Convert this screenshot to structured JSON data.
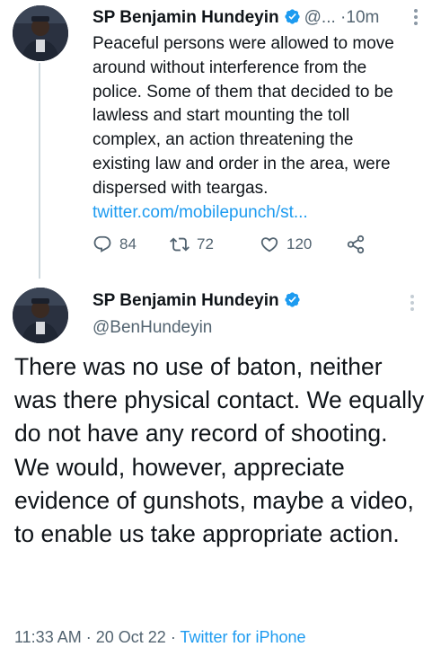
{
  "tweet1": {
    "author_name": "SP Benjamin Hundeyin",
    "handle_truncated": "@...",
    "separator": "·",
    "time": "10m",
    "text": "Peaceful persons were allowed to move around without interference from the police. Some of them that decided to be lawless and start mounting the toll complex, an action threatening the existing law and order in the area, were dispersed with teargas.",
    "link": "twitter.com/mobilepunch/st...",
    "replies": "84",
    "retweets": "72",
    "likes": "120"
  },
  "tweet2": {
    "author_name": "SP Benjamin Hundeyin",
    "handle": "@BenHundeyin",
    "text": "There was no use of baton, neither was there physical contact. We equally do not have any record of shooting. We would, however, appreciate evidence of gunshots, maybe a video, to enable us take appropriate action.",
    "time": "11:33 AM",
    "separator": "·",
    "date": "20 Oct 22",
    "separator2": "·",
    "source": "Twitter for iPhone"
  },
  "colors": {
    "accent": "#1d9bf0",
    "secondary_text": "#536471",
    "primary_text": "#0f1419"
  },
  "icons": [
    "verified-badge-icon",
    "more-icon",
    "reply-icon",
    "retweet-icon",
    "like-icon",
    "share-icon"
  ]
}
